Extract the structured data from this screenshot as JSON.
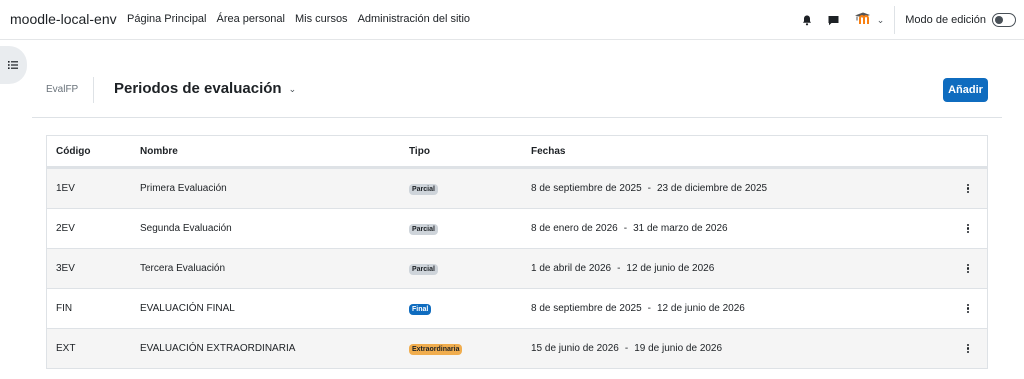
{
  "navbar": {
    "brand": "moodle-local-env",
    "links": [
      "Página Principal",
      "Área personal",
      "Mis cursos",
      "Administración del sitio"
    ],
    "icons": [
      "bell-icon",
      "chat-icon",
      "moodle-user-icon",
      "chevron-down-icon"
    ],
    "edit_mode_label": "Modo de edición",
    "edit_mode_on": false
  },
  "header": {
    "breadcrumb": "EvalFP",
    "title": "Periodos de evaluación",
    "add_label": "Añadir"
  },
  "colors": {
    "primary": "#0f6cbf",
    "badge_parcial": "#ced4da",
    "badge_final": "#0f6cbf",
    "badge_extra": "#f0ad4e"
  },
  "table": {
    "headers": [
      "Código",
      "Nombre",
      "Tipo",
      "Fechas"
    ],
    "rows": [
      {
        "code": "1EV",
        "name": "Primera Evaluación",
        "type": "Parcial",
        "start": "8 de septiembre de 2025",
        "end": "23 de diciembre de 2025"
      },
      {
        "code": "2EV",
        "name": "Segunda Evaluación",
        "type": "Parcial",
        "start": "8 de enero de 2026",
        "end": "31 de marzo de 2026"
      },
      {
        "code": "3EV",
        "name": "Tercera Evaluación",
        "type": "Parcial",
        "start": "1 de abril de 2026",
        "end": "12 de junio de 2026"
      },
      {
        "code": "FIN",
        "name": "EVALUACIÓN FINAL",
        "type": "Final",
        "start": "8 de septiembre de 2025",
        "end": "12 de junio de 2026"
      },
      {
        "code": "EXT",
        "name": "EVALUACIÓN EXTRAORDINARIA",
        "type": "Extraordinaria",
        "start": "15 de junio de 2026",
        "end": "19 de junio de 2026"
      }
    ],
    "date_separator": "-"
  }
}
